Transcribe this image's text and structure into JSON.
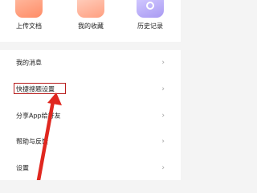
{
  "quick_actions": [
    {
      "label": "上传文档",
      "icon": "upload-doc-icon"
    },
    {
      "label": "我的收藏",
      "icon": "favorites-icon"
    },
    {
      "label": "历史记录",
      "icon": "history-icon"
    }
  ],
  "menu": [
    {
      "label": "我的消息"
    },
    {
      "label": "快捷搜题设置"
    },
    {
      "label": "分享App给好友"
    },
    {
      "label": "帮助与反馈"
    },
    {
      "label": "设置"
    }
  ],
  "chevron": "›",
  "annotation": {
    "highlight_color": "#b81d1d",
    "arrow_color": "#e0271f"
  }
}
